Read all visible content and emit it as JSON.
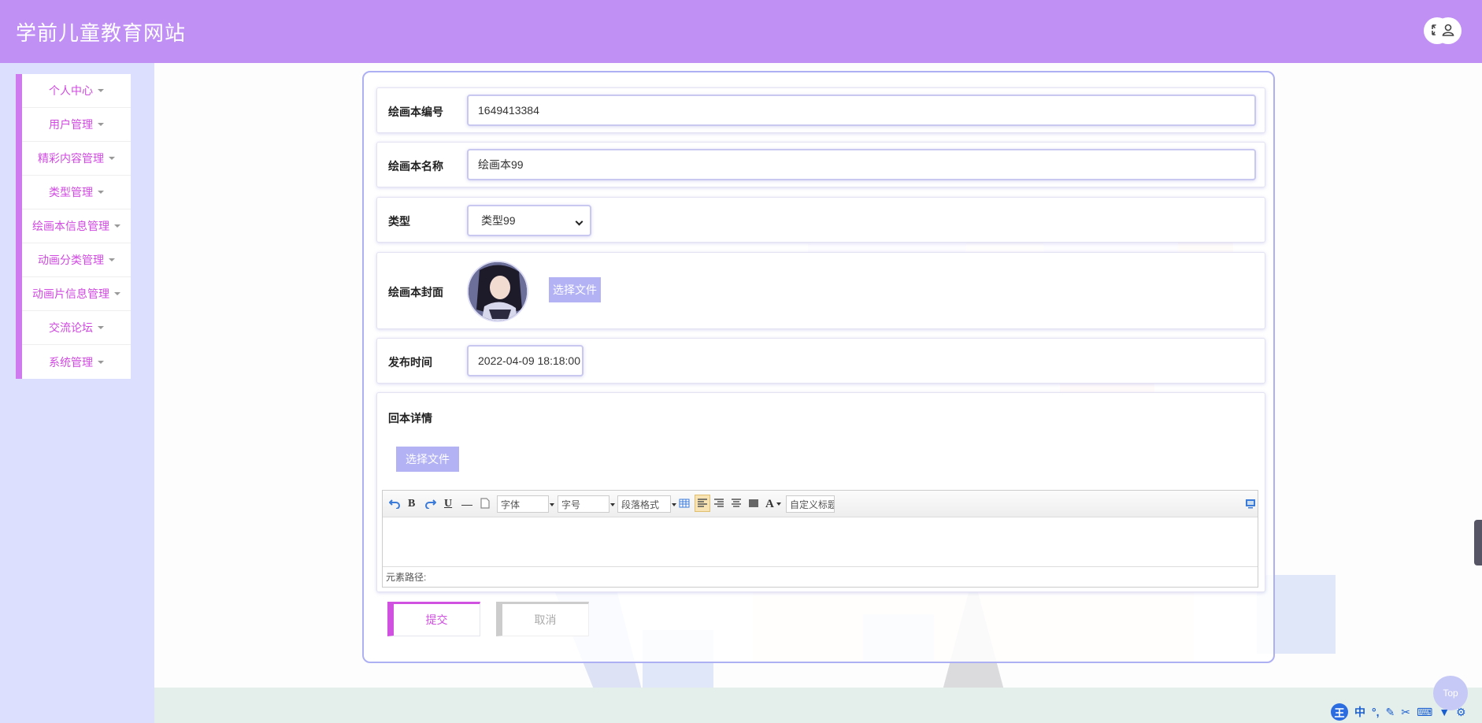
{
  "header": {
    "site_title": "学前儿童教育网站",
    "fullscreen_icon": "expand-icon",
    "user_icon": "user-icon"
  },
  "sidebar": {
    "items": [
      {
        "label": "个人中心"
      },
      {
        "label": "用户管理"
      },
      {
        "label": "精彩内容管理"
      },
      {
        "label": "类型管理"
      },
      {
        "label": "绘画本信息管理"
      },
      {
        "label": "动画分类管理"
      },
      {
        "label": "动画片信息管理"
      },
      {
        "label": "交流论坛"
      },
      {
        "label": "系统管理"
      }
    ]
  },
  "form": {
    "number": {
      "label": "绘画本编号",
      "value": "1649413384"
    },
    "name": {
      "label": "绘画本名称",
      "value": "绘画本99"
    },
    "type": {
      "label": "类型",
      "value": "类型99"
    },
    "cover": {
      "label": "绘画本封面",
      "button": "选择文件"
    },
    "publish_time": {
      "label": "发布时间",
      "value": "2022-04-09 18:18:00"
    },
    "details": {
      "label": "回本详情",
      "button": "选择文件"
    }
  },
  "editor": {
    "toolbar": {
      "undo_icon": "undo-icon",
      "bold": "B",
      "redo_icon": "redo-icon",
      "underline": "U",
      "hr": "—",
      "font_family": "字体",
      "font_size": "字号",
      "paragraph": "段落格式",
      "font_color": "A",
      "custom_title": "自定义标题"
    },
    "path_label": "元素路径:"
  },
  "actions": {
    "submit": "提交",
    "cancel": "取消"
  },
  "widgets": {
    "top": "Top",
    "ime_char": "王",
    "ime_mode": "中"
  },
  "colors": {
    "header": "#c090f5",
    "sidebar_bg": "#dcdffe",
    "menu_text": "#d04ae0",
    "accent_button": "#b3b2f5"
  }
}
